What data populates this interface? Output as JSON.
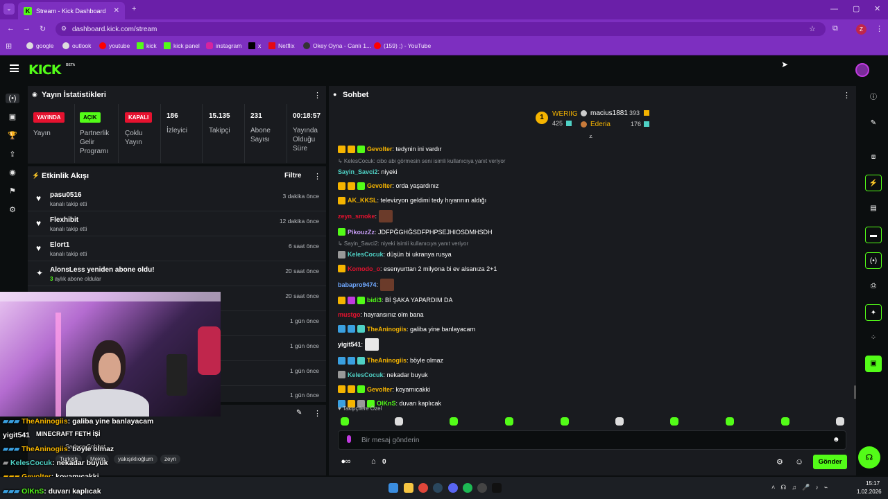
{
  "browser": {
    "tab_title": "Stream - Kick Dashboard",
    "url": "dashboard.kick.com/stream",
    "bookmarks": [
      "google",
      "outlook",
      "youtube",
      "kick",
      "kick panel",
      "instagram",
      "x",
      "Netflix",
      "Okey Oyna - Canlı 1...",
      "(159) ;) - YouTube"
    ],
    "profile_initial": "Z"
  },
  "header": {
    "logo": "KICK",
    "beta": "BETA"
  },
  "stats": {
    "title": "Yayın İstatistikleri",
    "badges": [
      {
        "badge": "YAYINDA",
        "label": "Yayın",
        "color": "#e6122f"
      },
      {
        "badge": "AÇIK",
        "label": "Partnerlik Gelir Programı",
        "color": "#53fc18"
      },
      {
        "badge": "KAPALI",
        "label": "Çoklu Yayın",
        "color": "#e6122f"
      }
    ],
    "items": [
      {
        "value": "186",
        "label": "İzleyici"
      },
      {
        "value": "15.135",
        "label": "Takipçi"
      },
      {
        "value": "231",
        "label": "Abone Sayısı"
      },
      {
        "value": "00:18:57",
        "label": "Yayında Olduğu Süre"
      }
    ]
  },
  "activity": {
    "title": "Etkinlik Akışı",
    "filter": "Filtre",
    "events": [
      {
        "name": "pasu0516",
        "sub": "kanalı takip etti",
        "time": "3 dakika önce",
        "icon": "heart-icon"
      },
      {
        "name": "Flexhibit",
        "sub": "kanalı takip etti",
        "time": "12 dakika önce",
        "icon": "heart-icon"
      },
      {
        "name": "Elort1",
        "sub": "kanalı takip etti",
        "time": "6 saat önce",
        "icon": "heart-icon"
      },
      {
        "name": "AlonsLess yeniden abone oldu!",
        "sub_num": "3",
        "sub": "aylık abone oldular",
        "time": "20 saat önce",
        "icon": "star-icon"
      },
      {
        "name": "",
        "sub": "",
        "time": "20 saat önce",
        "icon": ""
      },
      {
        "name": "",
        "sub": "",
        "time": "1 gün önce",
        "icon": ""
      },
      {
        "name": "",
        "sub": "",
        "time": "1 gün önce",
        "icon": ""
      },
      {
        "name": "",
        "sub": "",
        "time": "1 gün önce",
        "icon": ""
      },
      {
        "name": "",
        "sub": "",
        "time": "1 gün önce",
        "icon": ""
      }
    ]
  },
  "chat": {
    "title": "Sohbet",
    "leaderboard": {
      "first": {
        "rank": "1",
        "name": "WERIIG",
        "count": "425"
      },
      "second": {
        "name": "macius1881",
        "count": "393"
      },
      "third": {
        "name": "Ederia",
        "count": "176"
      }
    },
    "messages": [
      {
        "user": "Gevolter",
        "color": "#f5b400",
        "text": ": tedynin ini vardır",
        "badges": [
          "#f5b400",
          "#f5b400",
          "#53fc18"
        ]
      },
      {
        "reply": "KelesCocuk: cibo abi görmesin seni isimli kullanıcıya yanıt veriyor"
      },
      {
        "user": "Sayin_Savci2",
        "color": "#4fd1c5",
        "text": ": niyeki",
        "badges": []
      },
      {
        "user": "Gevolter",
        "color": "#f5b400",
        "text": ": orda yaşardınız",
        "badges": [
          "#f5b400",
          "#f5b400",
          "#53fc18"
        ]
      },
      {
        "user": "AK_KKSL",
        "color": "#f5b400",
        "text": ": televizyon geldimi tedy hıyarının aldığı",
        "badges": [
          "#f5b400"
        ]
      },
      {
        "user": "zeyn_smoke",
        "color": "#e6122f",
        "text": ":",
        "badges": [],
        "emote": true
      },
      {
        "user": "PikouzZz",
        "color": "#c69cf5",
        "text": ": JDFPĞGHĞSDFPHPSEJHIOSDMHSDH",
        "badges": [
          "#53fc18"
        ]
      },
      {
        "reply": "Sayin_Savci2: niyeki isimli kullanıcıya yanıt veriyor"
      },
      {
        "user": "KelesCocuk",
        "color": "#4fd1c5",
        "text": ": düşün bi ukranya rusya",
        "badges": [
          "#999"
        ]
      },
      {
        "user": "Komodo_o",
        "color": "#e6122f",
        "text": ": esenyurttan 2 milyona bi ev alsanıza 2+1",
        "badges": [
          "#f5b400"
        ]
      },
      {
        "user": "babapro9474",
        "color": "#6fa8ff",
        "text": ":",
        "badges": [],
        "emote": true
      },
      {
        "user": "bidi3",
        "color": "#53fc18",
        "text": ": Bİ ŞAKA YAPARDIM DA",
        "badges": [
          "#f5b400",
          "#c03adf",
          "#53fc18"
        ]
      },
      {
        "user": "mustgo",
        "color": "#e6122f",
        "text": ": hayransınız olm bana",
        "badges": []
      },
      {
        "user": "TheAninogiis",
        "color": "#f5b400",
        "text": ": galiba yine banlayacam",
        "badges": [
          "#3aa0e0",
          "#3aa0e0",
          "#4fd1c5"
        ]
      },
      {
        "user": "yigit541",
        "color": "#ffffff",
        "text": ":",
        "badges": [],
        "emote_light": true
      },
      {
        "user": "TheAninogiis",
        "color": "#f5b400",
        "text": ": böyle olmaz",
        "badges": [
          "#3aa0e0",
          "#3aa0e0",
          "#4fd1c5"
        ]
      },
      {
        "user": "KelesCocuk",
        "color": "#4fd1c5",
        "text": ": nekadar buyuk",
        "badges": [
          "#999"
        ]
      },
      {
        "user": "Gevolter",
        "color": "#f5b400",
        "text": ": koyamıcakki",
        "badges": [
          "#f5b400",
          "#f5b400",
          "#53fc18"
        ]
      },
      {
        "user": "OlKnS",
        "color": "#53fc18",
        "text": ": duvarı kaplıcak",
        "badges": [
          "#3aa0e0",
          "#f5b400",
          "#999",
          "#53fc18"
        ]
      }
    ],
    "followers_only": "Takipçilere Özel",
    "input_placeholder": "Bir mesaj gönderin",
    "points": "0",
    "send": "Gönder"
  },
  "overlay": {
    "lines": [
      {
        "user": "TheAninogiis",
        "text": ": galiba yine banlayacam",
        "color": "#f5b400"
      },
      {
        "user": "yigit541",
        "text": "",
        "color": "#ffffff"
      },
      {
        "user": "TheAninogiis",
        "text": ": böyle olmaz",
        "color": "#f5b400"
      },
      {
        "user": "KelesCocuk",
        "text": ": nekadar buyuk",
        "color": "#4fd1c5"
      },
      {
        "user": "Gevolter",
        "text": ": koyamıcakki",
        "color": "#f5b400"
      },
      {
        "user": "OlKnS",
        "text": ": duvarı kaplıcak",
        "color": "#53fc18"
      }
    ],
    "stream_title": "MINECRAFT FETH İŞİ",
    "chat_mode": "Sadece Sohbet",
    "tags": [
      "Turkish",
      "Mekip",
      "yakışıklıoğlum",
      "zeyn"
    ]
  },
  "taskbar": {
    "time": "15:17",
    "date": "1.02.2026"
  },
  "colors": {
    "accent": "#53fc18",
    "live": "#e6122f",
    "browser": "#7d2fc0"
  }
}
